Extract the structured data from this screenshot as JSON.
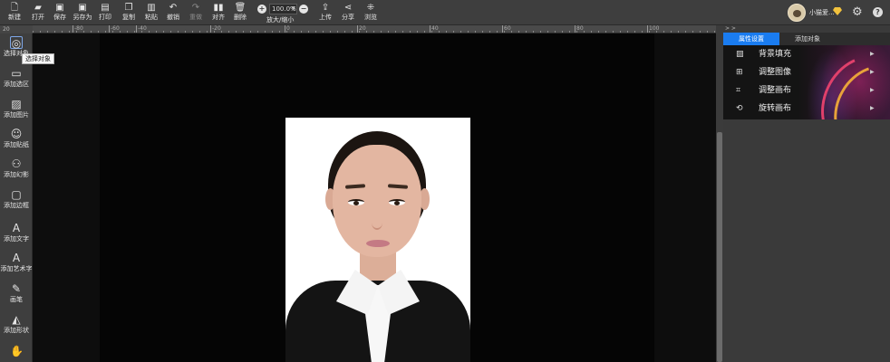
{
  "toolbar": {
    "buttons": [
      {
        "label": "新建",
        "icon": "new-file-icon",
        "glyph": "🗋"
      },
      {
        "label": "打开",
        "icon": "folder-open-icon",
        "glyph": "▰"
      },
      {
        "label": "保存",
        "icon": "save-icon",
        "glyph": "▣"
      },
      {
        "label": "另存为",
        "icon": "save-as-icon",
        "glyph": "▣"
      },
      {
        "label": "打印",
        "icon": "print-icon",
        "glyph": "▤"
      },
      {
        "label": "复制",
        "icon": "copy-icon",
        "glyph": "❐"
      },
      {
        "label": "粘贴",
        "icon": "paste-icon",
        "glyph": "▥"
      },
      {
        "label": "撤销",
        "icon": "undo-icon",
        "glyph": "↶"
      },
      {
        "label": "重做",
        "icon": "redo-icon",
        "glyph": "↷"
      },
      {
        "label": "对齐",
        "icon": "align-icon",
        "glyph": "▮▮"
      },
      {
        "label": "删除",
        "icon": "trash-icon",
        "glyph": "🗑"
      }
    ],
    "zoom": {
      "value": "100.0%",
      "label": "放大/缩小"
    },
    "upload_label": "上传",
    "share_label": "分享",
    "browse_label": "浏览",
    "user_name": "小猫爱..."
  },
  "ruler": {
    "corner": "20",
    "labels": [
      "-80",
      "-60",
      "-40",
      "-20",
      "0",
      "20",
      "40",
      "60",
      "80",
      "100"
    ]
  },
  "tools": [
    {
      "label": "选择对象",
      "icon": "select-object-icon",
      "glyph": "◎"
    },
    {
      "label": "添加选区",
      "icon": "add-selection-icon",
      "glyph": "▭"
    },
    {
      "label": "添加图片",
      "icon": "add-image-icon",
      "glyph": "▨"
    },
    {
      "label": "添加贴纸",
      "icon": "add-sticker-icon",
      "glyph": "☺"
    },
    {
      "label": "添加幻影",
      "icon": "add-phantom-icon",
      "glyph": "⚇"
    },
    {
      "label": "添加边框",
      "icon": "add-border-icon",
      "glyph": "▢"
    },
    {
      "label": "添加文字",
      "icon": "add-text-icon",
      "glyph": "A"
    },
    {
      "label": "添加艺术字",
      "icon": "add-art-text-icon",
      "glyph": "A"
    },
    {
      "label": "画笔",
      "icon": "brush-icon",
      "glyph": "✎"
    },
    {
      "label": "添加形状",
      "icon": "add-shape-icon",
      "glyph": "◭"
    },
    {
      "label": "",
      "icon": "hand-icon",
      "glyph": "✋"
    }
  ],
  "tooltip": "选择对象",
  "right_panel": {
    "collapse_label": "> >",
    "tabs": [
      "属性设置",
      "添加对象"
    ],
    "items": [
      {
        "label": "背景填充",
        "icon": "background-fill-icon",
        "glyph": "▨"
      },
      {
        "label": "调整图像",
        "icon": "adjust-image-icon",
        "glyph": "⊞"
      },
      {
        "label": "调整画布",
        "icon": "adjust-canvas-icon",
        "glyph": "⌗"
      },
      {
        "label": "旋转画布",
        "icon": "rotate-canvas-icon",
        "glyph": "⟲"
      }
    ]
  }
}
